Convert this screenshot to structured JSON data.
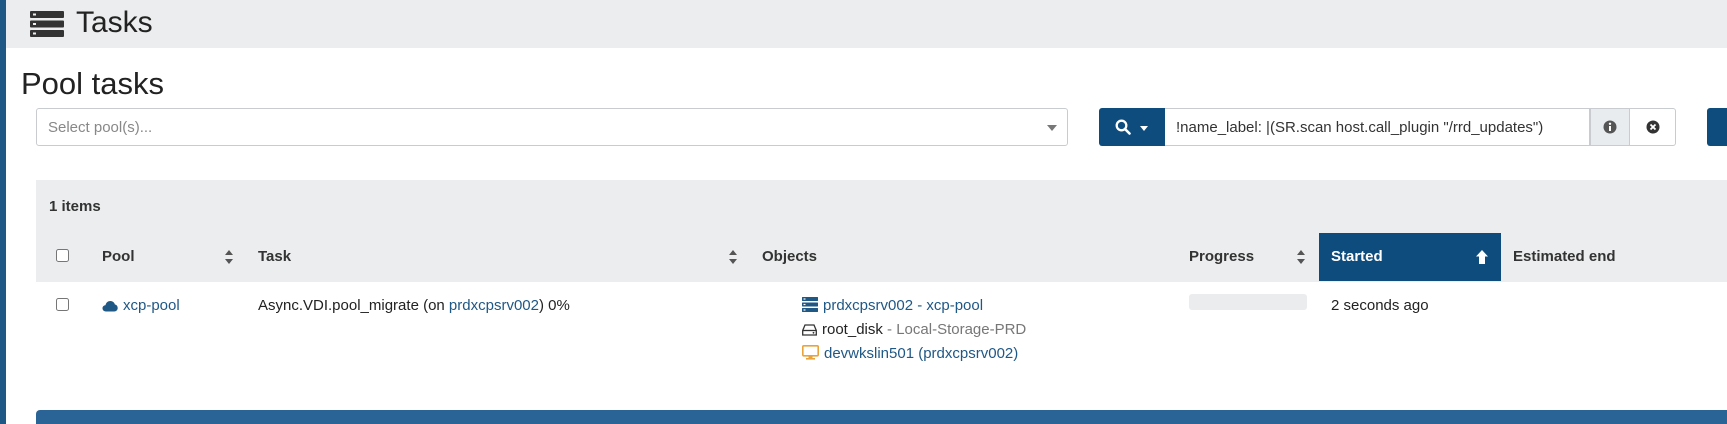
{
  "header": {
    "title": "Tasks",
    "icon": "tasks-icon"
  },
  "page": {
    "title": "Pool tasks"
  },
  "pool_select": {
    "placeholder": "Select pool(s)..."
  },
  "search": {
    "value": "!name_label: |(SR.scan host.call_plugin \"/rrd_updates\")"
  },
  "table": {
    "items_count": "1 items",
    "columns": {
      "pool": "Pool",
      "task": "Task",
      "objects": "Objects",
      "progress": "Progress",
      "started": "Started",
      "estimated_end": "Estimated end"
    },
    "rows": [
      {
        "pool": "xcp-pool",
        "task_prefix": "Async.VDI.pool_migrate (on ",
        "task_host": "prdxcpsrv002",
        "task_suffix": ") 0%",
        "objects": [
          {
            "name": "prdxcpsrv002 - xcp-pool",
            "icon": "server-icon"
          },
          {
            "name": "root_disk",
            "detail": "- Local-Storage-PRD",
            "icon": "disk-icon"
          },
          {
            "name": "devwkslin501 (prdxcpsrv002)",
            "icon": "desktop-icon"
          }
        ],
        "progress": 0,
        "started": "2 seconds ago"
      }
    ]
  },
  "colors": {
    "primary": "#0d4c7d",
    "link": "#1f5785",
    "panel": "#ebedee",
    "vm_icon": "#e8a33d"
  }
}
